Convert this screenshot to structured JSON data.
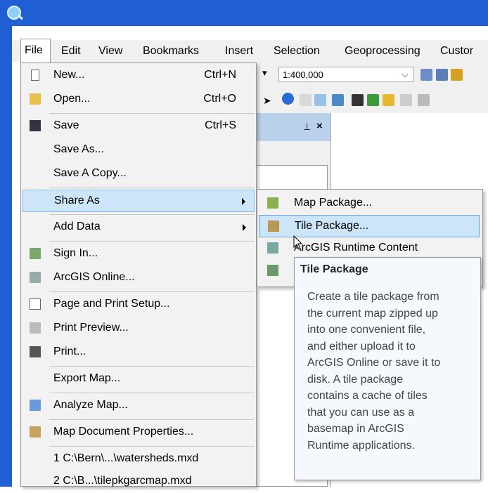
{
  "menubar": {
    "items": [
      "File",
      "Edit",
      "View",
      "Bookmarks",
      "Insert",
      "Selection",
      "Geoprocessing",
      "Custor"
    ]
  },
  "toolbar": {
    "scale_value": "1:400,000"
  },
  "file_menu": {
    "items": [
      {
        "label": "New...",
        "shortcut": "Ctrl+N"
      },
      {
        "label": "Open...",
        "shortcut": "Ctrl+O"
      },
      {
        "label": "Save",
        "shortcut": "Ctrl+S"
      },
      {
        "label": "Save As...",
        "shortcut": ""
      },
      {
        "label": "Save A Copy...",
        "shortcut": ""
      },
      {
        "label": "Share As",
        "shortcut": ""
      },
      {
        "label": "Add Data",
        "shortcut": ""
      },
      {
        "label": "Sign In...",
        "shortcut": ""
      },
      {
        "label": "ArcGIS Online...",
        "shortcut": ""
      },
      {
        "label": "Page and Print Setup...",
        "shortcut": ""
      },
      {
        "label": "Print Preview...",
        "shortcut": ""
      },
      {
        "label": "Print...",
        "shortcut": ""
      },
      {
        "label": "Export Map...",
        "shortcut": ""
      },
      {
        "label": "Analyze Map...",
        "shortcut": ""
      },
      {
        "label": "Map Document Properties...",
        "shortcut": ""
      },
      {
        "label": "1 C:\\Bern\\...\\watersheds.mxd",
        "shortcut": ""
      },
      {
        "label": "2 C:\\B...\\tilepkgarcmap.mxd",
        "shortcut": ""
      }
    ]
  },
  "share_as_submenu": {
    "items": [
      {
        "label": "Map Package..."
      },
      {
        "label": "Tile Package..."
      },
      {
        "label": "ArcGIS Runtime Content"
      }
    ]
  },
  "tooltip": {
    "title": "Tile Package",
    "lines": [
      "Create a tile package from",
      "the current map zipped up",
      "into one convenient file,",
      "and either upload it to",
      "ArcGIS Online or save it to",
      "disk. A tile package",
      "contains a cache of tiles",
      "that you can use as a",
      "basemap in ArcGIS",
      "Runtime applications."
    ]
  },
  "colors": {
    "titlebar": "#1f5ed3",
    "highlight": "#cde5f9",
    "menu_bg": "#f2f2f2"
  }
}
